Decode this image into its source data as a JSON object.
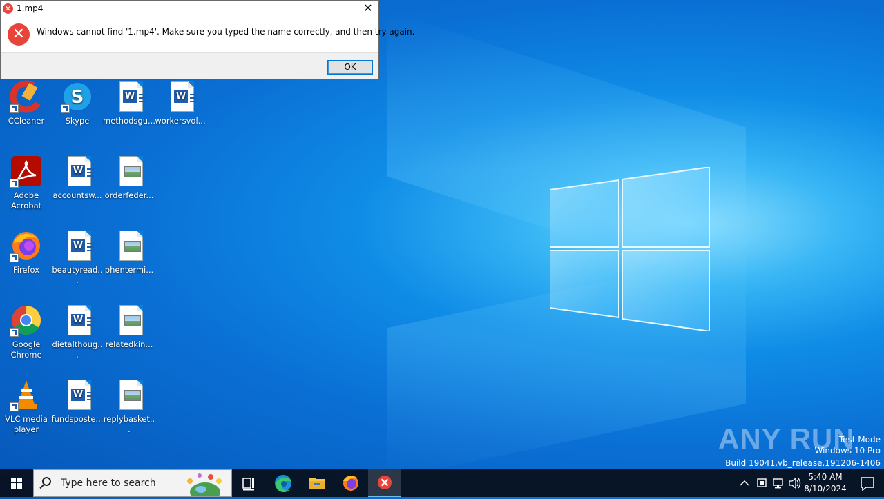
{
  "dialog": {
    "title": "1.mp4",
    "message": "Windows cannot find '1.mp4'. Make sure you typed the name correctly, and then try again.",
    "ok_label": "OK",
    "close_glyph": "✕",
    "error_glyph": "✕"
  },
  "desktop": {
    "icons": [
      {
        "label": "CCleaner",
        "icon": "ccleaner-icon"
      },
      {
        "label": "Skype",
        "icon": "skype-icon"
      },
      {
        "label": "methodsgu...",
        "icon": "word-doc-icon"
      },
      {
        "label": "workersvol...",
        "icon": "word-doc-icon"
      },
      {
        "label": "Adobe Acrobat",
        "icon": "acrobat-icon"
      },
      {
        "label": "accountsw...",
        "icon": "word-doc-icon"
      },
      {
        "label": "orderfeder...",
        "icon": "image-file-icon"
      },
      {
        "label": "Firefox",
        "icon": "firefox-icon"
      },
      {
        "label": "beautyread...",
        "icon": "word-doc-icon"
      },
      {
        "label": "phentermi...",
        "icon": "image-file-icon"
      },
      {
        "label": "Google Chrome",
        "icon": "chrome-icon"
      },
      {
        "label": "dietalthoug...",
        "icon": "word-doc-icon"
      },
      {
        "label": "relatedkin...",
        "icon": "image-file-icon"
      },
      {
        "label": "VLC media player",
        "icon": "vlc-icon"
      },
      {
        "label": "fundsposte...",
        "icon": "word-doc-icon"
      },
      {
        "label": "replybasket...",
        "icon": "image-file-icon"
      }
    ]
  },
  "watermark": {
    "brand": "ANY RUN",
    "test_mode": "Test Mode",
    "edition": "Windows 10 Pro",
    "build": "Build 19041.vb_release.191206-1406"
  },
  "taskbar": {
    "search_placeholder": "Type here to search",
    "apps": [
      "task-view-icon",
      "edge-icon",
      "file-explorer-icon",
      "firefox-icon",
      "error-app-icon"
    ],
    "active_app": "error-app-icon",
    "time": "5:40 AM",
    "date": "8/10/2024"
  },
  "colors": {
    "accent": "#0078d7",
    "error_red": "#e8443a",
    "desktop_blue": "#0a6fd4",
    "taskbar": "#08121f"
  }
}
